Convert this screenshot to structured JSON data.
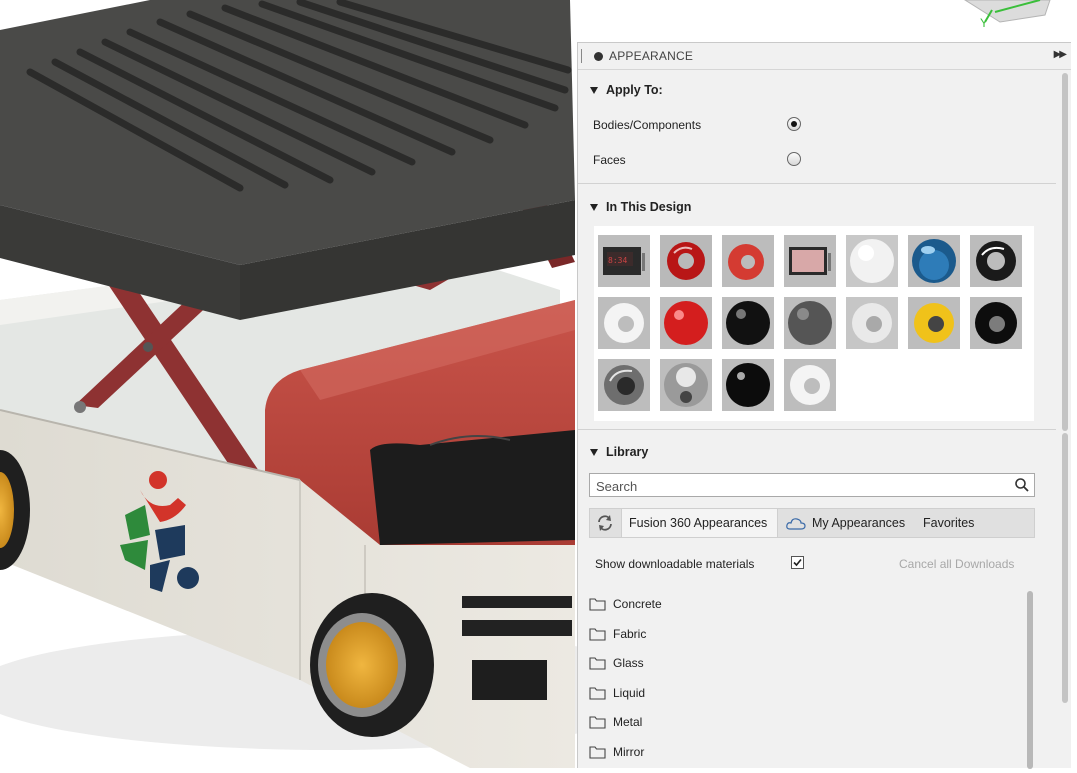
{
  "panel": {
    "title": "APPEARANCE",
    "apply_to": {
      "heading": "Apply To:",
      "options": [
        {
          "label": "Bodies/Components",
          "selected": true
        },
        {
          "label": "Faces",
          "selected": false
        }
      ]
    },
    "in_this_design": {
      "heading": "In This Design",
      "swatches": [
        {
          "name": "screen-device",
          "row": 0
        },
        {
          "name": "red-torus-gloss",
          "row": 0
        },
        {
          "name": "red-torus-matte",
          "row": 0
        },
        {
          "name": "pink-screen-device",
          "row": 0
        },
        {
          "name": "white-sphere",
          "row": 0
        },
        {
          "name": "blue-glass-sphere",
          "row": 0
        },
        {
          "name": "black-chrome-torus",
          "row": 0
        },
        {
          "name": "white-torus",
          "row": 1
        },
        {
          "name": "red-sphere",
          "row": 1
        },
        {
          "name": "black-sphere",
          "row": 1
        },
        {
          "name": "dark-gray-sphere",
          "row": 1
        },
        {
          "name": "white-gray-torus",
          "row": 1
        },
        {
          "name": "yellow-torus",
          "row": 1
        },
        {
          "name": "black-torus",
          "row": 1
        },
        {
          "name": "steel-torus",
          "row": 2
        },
        {
          "name": "chrome-sphere",
          "row": 2
        },
        {
          "name": "black-gloss-sphere",
          "row": 2
        },
        {
          "name": "white-torus-2",
          "row": 2
        }
      ]
    },
    "library": {
      "heading": "Library",
      "search_placeholder": "Search",
      "tabs": {
        "fusion": "Fusion 360 Appearances",
        "my": "My Appearances",
        "favorites": "Favorites"
      },
      "show_downloadable": "Show downloadable materials",
      "show_downloadable_checked": true,
      "cancel_downloads": "Cancel all Downloads",
      "folders": [
        "Concrete",
        "Fabric",
        "Glass",
        "Liquid",
        "Metal",
        "Mirror"
      ]
    }
  },
  "viewcube_axis": "Y",
  "colors": {
    "panel_bg": "#f1f1f1",
    "car_body": "#e7e4dc",
    "car_red": "#c0463c",
    "roof_dark": "#444444",
    "lift_red": "#8e3232",
    "wheel_yellow": "#e3a52c"
  }
}
